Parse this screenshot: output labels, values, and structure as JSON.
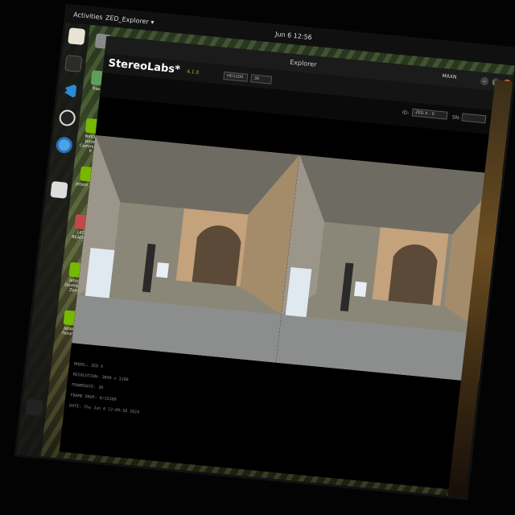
{
  "topbar": {
    "activities": "Activities",
    "app_menu": "ZED_Explorer ▾",
    "clock": "Jun 6  12:56"
  },
  "desktop": {
    "icons": [
      {
        "label": "",
        "icon": "home-folder-icon"
      },
      {
        "label": "Trash",
        "icon": "trash-icon"
      },
      {
        "label": "NVIDIA Jetson Community P",
        "icon": "nvidia-icon"
      },
      {
        "label": "Jetson Zoo",
        "icon": "nvidia-icon"
      },
      {
        "label": "L4T-README",
        "icon": "folder-icon"
      },
      {
        "label": "Jetson Developer Zone",
        "icon": "nvidia-icon"
      },
      {
        "label": "Jetson Forums",
        "icon": "nvidia-icon"
      }
    ]
  },
  "window": {
    "title": "Explorer",
    "brand": "StereoLabs*",
    "version": "4.1.0",
    "resolution_select": "HD1200",
    "fps_select": "30",
    "id_label": "ID:",
    "id_select": "ZED X - 0",
    "sn_label": "SN:",
    "sn_value": "",
    "system_user": "MAXN"
  },
  "camera_info": {
    "model": "MODEL: ZED X",
    "resolution": "RESOLUTION: 3840 x 1200",
    "framerate": "FRAMERATE: 30",
    "frame_drop": "FRAME DROP: 0/15380",
    "date": "DATE: Thu Jun 6 12:09:58 2024"
  },
  "colors": {
    "accent": "#e0592a",
    "brand_text": "#ffffff",
    "version": "#b9a15a"
  }
}
